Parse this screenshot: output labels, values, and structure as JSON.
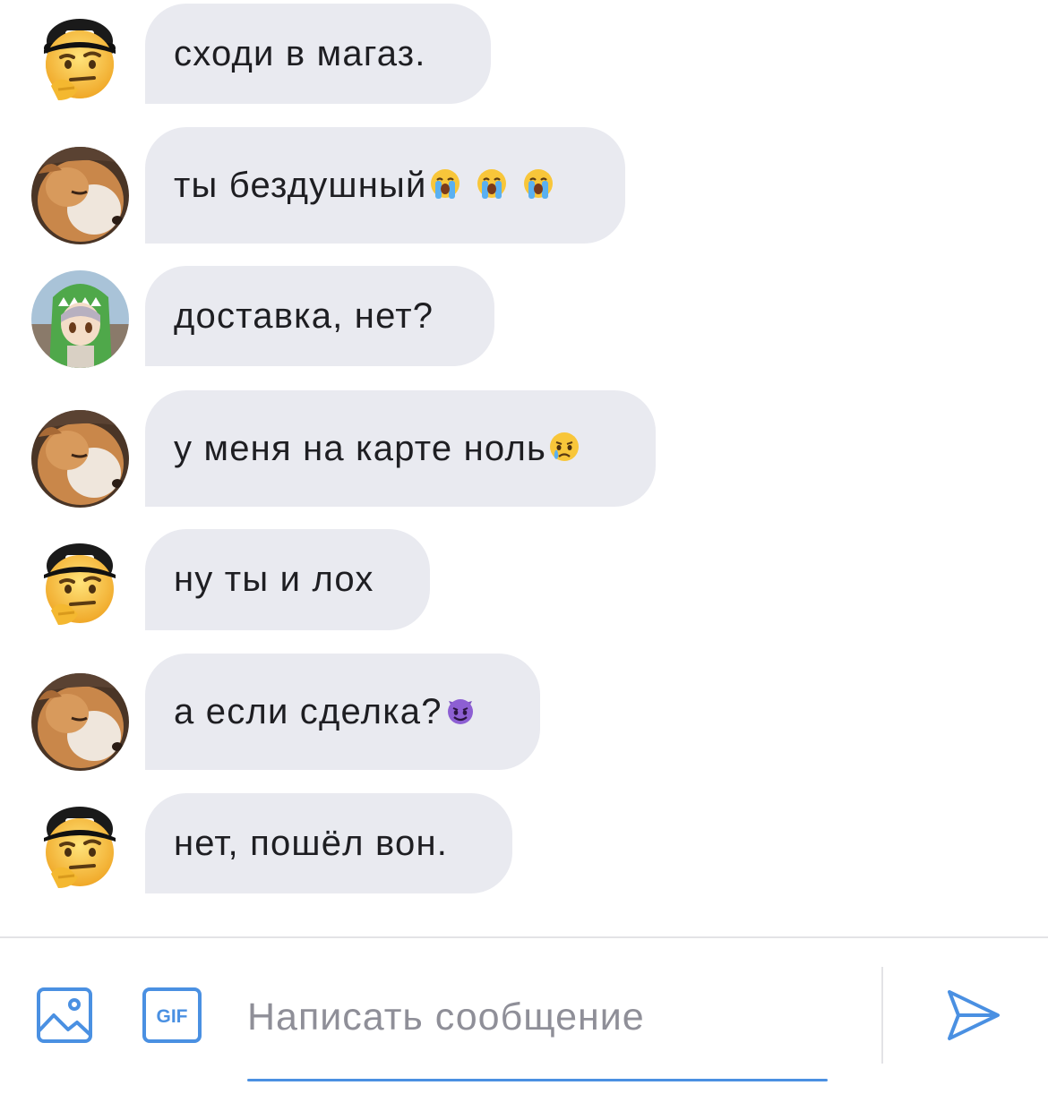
{
  "messages": [
    {
      "avatar": "thinking-cap-emoji-avatar",
      "text": "сходи в магаз.",
      "emojis": []
    },
    {
      "avatar": "shiba-dog-avatar",
      "text": "ты бездушный",
      "emojis": [
        "loudly-crying-face",
        "loudly-crying-face",
        "loudly-crying-face"
      ]
    },
    {
      "avatar": "anime-green-hood-avatar",
      "text": "доставка, нет?",
      "emojis": []
    },
    {
      "avatar": "shiba-dog-avatar",
      "text": "у меня на карте ноль",
      "emojis": [
        "crying-face"
      ]
    },
    {
      "avatar": "thinking-cap-emoji-avatar",
      "text": "ну ты и лох",
      "emojis": []
    },
    {
      "avatar": "shiba-dog-avatar",
      "text": "а если сделка?",
      "emojis": [
        "smiling-face-with-horns"
      ]
    },
    {
      "avatar": "thinking-cap-emoji-avatar",
      "text": "нет, пошёл вон.",
      "emojis": []
    }
  ],
  "composer": {
    "placeholder": "Написать сообщение",
    "value": "",
    "photo_icon": "image-icon",
    "gif_icon": "gif-icon",
    "gif_label": "GIF",
    "send_icon": "send-icon"
  },
  "colors": {
    "bubble": "#e9eaf0",
    "accent": "#4a90e2",
    "text": "#1e1e22",
    "placeholder": "#8f8f98"
  }
}
